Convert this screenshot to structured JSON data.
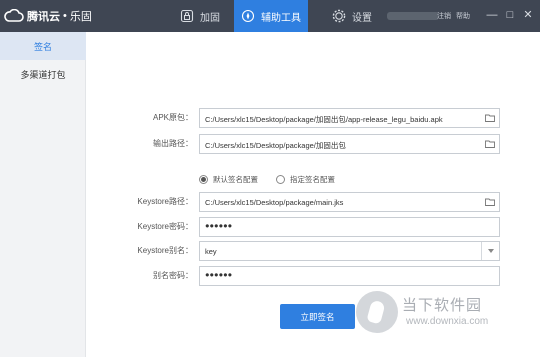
{
  "app": {
    "name": "腾讯云",
    "separator": "•",
    "product": "乐固"
  },
  "titlebar": {
    "tabs": [
      {
        "label": "加固",
        "icon": "lock-icon"
      },
      {
        "label": "辅助工具",
        "icon": "compass-icon",
        "active": true
      },
      {
        "label": "设置",
        "icon": "gear-icon"
      }
    ],
    "logout_label": "注销",
    "help_label": "帮助",
    "window_controls": [
      "—",
      "□",
      "✕"
    ]
  },
  "sidebar": {
    "items": [
      {
        "label": "签名",
        "active": true
      },
      {
        "label": "多渠道打包"
      }
    ]
  },
  "form": {
    "apk_label": "APK原包：",
    "apk_value": "C:/Users/xlc15/Desktop/package/加固出包/app-release_legu_baidu.apk",
    "output_label": "输出路径：",
    "output_value": "C:/Users/xlc15/Desktop/package/加固出包",
    "radio_default": "默认签名配置",
    "radio_custom": "指定签名配置",
    "keystore_path_label": "Keystore路径：",
    "keystore_path_value": "C:/Users/xlc15/Desktop/package/main.jks",
    "keystore_pw_label": "Keystore密码：",
    "keystore_pw_value": "●●●●●●",
    "alias_label": "Keystore别名：",
    "alias_value": "key",
    "alias_pw_label": "别名密码：",
    "alias_pw_value": "●●●●●●",
    "submit_label": "立即签名"
  },
  "watermark": {
    "title": "当下软件园",
    "url": "www.downxia.com"
  },
  "colors": {
    "accent": "#2f7fe0",
    "titlebar": "#3f4653",
    "sidebar": "#f2f3f5"
  }
}
